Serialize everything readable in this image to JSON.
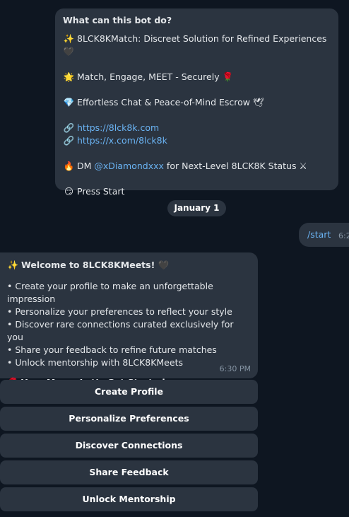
{
  "about": {
    "title": "What can this bot do?",
    "lines": [
      {
        "icon": "sparkles-icon",
        "glyph": "✨",
        "text": "8LCK8KMatch: Discreet Solution for Refined Experiences",
        "trail_icon": "black-heart-icon",
        "trail_glyph": "🖤"
      },
      {
        "icon": "star-icon",
        "glyph": "🌟",
        "text": "Match, Engage, MEET - Securely",
        "trail_icon": "rose-icon",
        "trail_glyph": "🌹"
      },
      {
        "icon": "gem-icon",
        "glyph": "💎",
        "text": "Effortless Chat & Peace-of-Mind Escrow",
        "trail_icon": "dove-icon",
        "trail_glyph": "🕊"
      }
    ],
    "links": [
      {
        "icon": "link-icon",
        "glyph": "🔗",
        "url": "https://8lck8k.com"
      },
      {
        "icon": "link-icon",
        "glyph": "🔗",
        "url": "https://x.com/8lck8k"
      }
    ],
    "dm": {
      "icon": "fire-icon",
      "glyph": "🔥",
      "prefix": "DM",
      "handle": "@xDiamondxxx",
      "suffix": "for Next-Level 8LCK8K Status",
      "trail_icon": "crossed-swords-icon",
      "trail_glyph": "⚔"
    },
    "press": {
      "icon": "smirk-icon",
      "glyph": "😏",
      "text": "Press Start"
    }
  },
  "date_divider": "January 1",
  "outgoing": {
    "text": "/start",
    "time": "6:2"
  },
  "welcome": {
    "title": "Welcome to 8LCK8KMeets!",
    "title_icon": "sparkles-icon",
    "title_glyph": "✨",
    "title_trail_icon": "black-heart-icon",
    "title_trail_glyph": "🖤",
    "items": [
      "• Create your profile to make an unforgettable impression",
      "• Personalize your preferences to reflect your style",
      "• Discover rare connections curated exclusively for you",
      "• Share your feedback to refine future matches",
      "• Unlock mentorship with 8LCK8KMeets"
    ],
    "cta_icon": "rose-icon",
    "cta_glyph": "🌹",
    "cta": "Your Move. Let’s Get Started.",
    "time": "6:30 PM"
  },
  "keyboard": [
    "Create Profile",
    "Personalize Preferences",
    "Discover Connections",
    "Share Feedback",
    "Unlock Mentorship"
  ],
  "colors": {
    "background": "#0e1621",
    "bubble": "#2b3440",
    "link": "#6ab3f3",
    "meta": "#8594a3"
  }
}
